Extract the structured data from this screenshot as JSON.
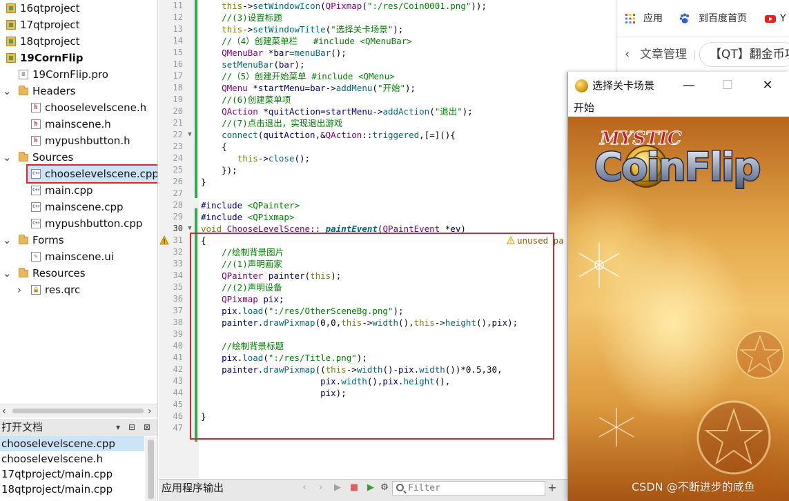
{
  "project_tree": {
    "items": [
      {
        "label": "16qtproject",
        "type": "project",
        "bold": false
      },
      {
        "label": "17qtproject",
        "type": "project",
        "bold": false
      },
      {
        "label": "18qtproject",
        "type": "project",
        "bold": false
      },
      {
        "label": "19CornFlip",
        "type": "project",
        "bold": true
      },
      {
        "label": "19CornFlip.pro",
        "type": "pro"
      },
      {
        "label": "Headers",
        "type": "folder",
        "expanded": true
      },
      {
        "label": "chooselevelscene.h",
        "type": "h"
      },
      {
        "label": "mainscene.h",
        "type": "h"
      },
      {
        "label": "mypushbutton.h",
        "type": "h"
      },
      {
        "label": "Sources",
        "type": "folder",
        "expanded": true
      },
      {
        "label": "chooselevelscene.cpp",
        "type": "cpp",
        "selected": true
      },
      {
        "label": "main.cpp",
        "type": "cpp"
      },
      {
        "label": "mainscene.cpp",
        "type": "cpp"
      },
      {
        "label": "mypushbutton.cpp",
        "type": "cpp"
      },
      {
        "label": "Forms",
        "type": "folder",
        "expanded": true
      },
      {
        "label": "mainscene.ui",
        "type": "ui"
      },
      {
        "label": "Resources",
        "type": "folder",
        "expanded": true
      },
      {
        "label": "res.qrc",
        "type": "qrc",
        "collapsed": true
      }
    ]
  },
  "open_documents": {
    "title": "打开文档",
    "items": [
      "chooselevelscene.cpp",
      "chooselevelscene.h",
      "17qtproject/main.cpp",
      "18qtproject/main.cpp"
    ]
  },
  "editor": {
    "highlight_color": "#d9252e",
    "warning_text": "unused pa",
    "warning_line": 30,
    "lines": [
      {
        "n": 11,
        "html": "    <span class='k'>this</span>-&gt;<span class='f'>setWindowIcon</span>(<span class='t'>QPixmap</span>(<span class='s'>\":/res/Coin0001.png\"</span>));"
      },
      {
        "n": 12,
        "html": "    <span class='cm'>//(3)设置标题</span>"
      },
      {
        "n": 13,
        "html": "    <span class='k'>this</span>-&gt;<span class='f'>setWindowTitle</span>(<span class='s'>\"选择关卡场景\"</span>);"
      },
      {
        "n": 14,
        "html": "    <span class='cm'>//（4）创建菜单栏   #include &lt;QMenuBar&gt;</span>"
      },
      {
        "n": 15,
        "html": "    <span class='t'>QMenuBar</span> *<span class='n'>bar</span>=<span class='f'>menuBar</span>();"
      },
      {
        "n": 16,
        "html": "    <span class='f'>setMenuBar</span>(<span class='n'>bar</span>);"
      },
      {
        "n": 17,
        "html": "    <span class='cm'>//（5）创建开始菜单 #include &lt;QMenu&gt;</span>"
      },
      {
        "n": 18,
        "html": "    <span class='t'>QMenu</span> *<span class='n'>startMenu</span>=<span class='n'>bar</span>-&gt;<span class='f'>addMenu</span>(<span class='s'>\"开始\"</span>);"
      },
      {
        "n": 19,
        "html": "    <span class='cm'>//(6)创建菜单项</span>"
      },
      {
        "n": 20,
        "html": "    <span class='t'>QAction</span> *<span class='n'>quitAction</span>=<span class='n'>startMenu</span>-&gt;<span class='f'>addAction</span>(<span class='s'>\"退出\"</span>);"
      },
      {
        "n": 21,
        "html": "    <span class='cm'>//(7)点击退出，实现退出游戏</span>"
      },
      {
        "n": 22,
        "html": "    <span class='f'>connect</span>(<span class='n'>quitAction</span>,&amp;<span class='t'>QAction</span>::<span class='f'>triggered</span>,[=](){"
      },
      {
        "n": 23,
        "html": "    {"
      },
      {
        "n": 24,
        "html": "       <span class='k'>this</span>-&gt;<span class='f'>close</span>();"
      },
      {
        "n": 25,
        "html": "    });"
      },
      {
        "n": 26,
        "html": "}"
      },
      {
        "n": 27,
        "html": ""
      },
      {
        "n": 28,
        "html": "<span class='pp'>#include</span> <span class='s'>&lt;QPainter&gt;</span>"
      },
      {
        "n": 29,
        "html": "<span class='pp'>#include</span> <span class='s'>&lt;QPixmap&gt;</span>"
      },
      {
        "n": 30,
        "html": "<span class='k'>void</span> <span class='t'>ChooseLevelScene</span>:: <span class='fi'>paintEvent</span>(<span class='t'>QPaintEvent</span> *<span class='n' style='text-decoration:underline'>ev</span>)"
      },
      {
        "n": 31,
        "html": "{"
      },
      {
        "n": 32,
        "html": "    <span class='cm'>//绘制背景图片</span>"
      },
      {
        "n": 33,
        "html": "    <span class='cm'>//(1)声明画家</span>"
      },
      {
        "n": 34,
        "html": "    <span class='t'>QPainter</span> <span class='n'>painter</span>(<span class='k'>this</span>);"
      },
      {
        "n": 35,
        "html": "    <span class='cm'>//(2)声明设备</span>"
      },
      {
        "n": 36,
        "html": "    <span class='t'>QPixmap</span> <span class='n'>pix</span>;"
      },
      {
        "n": 37,
        "html": "    <span class='n'>pix</span>.<span class='f'>load</span>(<span class='s'>\":/res/OtherSceneBg.png\"</span>);"
      },
      {
        "n": 38,
        "html": "    <span class='n'>painter</span>.<span class='f'>drawPixmap</span>(0,0,<span class='k'>this</span>-&gt;<span class='f'>width</span>(),<span class='k'>this</span>-&gt;<span class='f'>height</span>(),<span class='n'>pix</span>);"
      },
      {
        "n": 39,
        "html": ""
      },
      {
        "n": 40,
        "html": "    <span class='cm'>//绘制背景标题</span>"
      },
      {
        "n": 41,
        "html": "    <span class='n'>pix</span>.<span class='f'>load</span>(<span class='s'>\":/res/Title.png\"</span>);"
      },
      {
        "n": 42,
        "html": "    <span class='n'>painter</span>.<span class='f'>drawPixmap</span>((<span class='k'>this</span>-&gt;<span class='f'>width</span>()-<span class='n'>pix</span>.<span class='f'>width</span>())*0.5,30,"
      },
      {
        "n": 43,
        "html": "                       <span class='n'>pix</span>.<span class='f'>width</span>(),<span class='n'>pix</span>.<span class='f'>height</span>(),"
      },
      {
        "n": 44,
        "html": "                       <span class='n'>pix</span>);"
      },
      {
        "n": 45,
        "html": ""
      },
      {
        "n": 46,
        "html": "}"
      },
      {
        "n": 47,
        "html": ""
      }
    ]
  },
  "output_bar": {
    "title": "应用程序输出",
    "filter_placeholder": "Filter"
  },
  "browser": {
    "bookmarks": [
      {
        "label": "应用",
        "icon": "apps-grid-icon"
      },
      {
        "label": "到百度首页",
        "icon": "baidu-paw-icon"
      },
      {
        "label": "Y",
        "icon": "youtube-icon"
      }
    ],
    "back_label": "文章管理",
    "article_title": "【QT】翻金币项"
  },
  "app_window": {
    "title": "选择关卡场景",
    "menu_label": "开始",
    "scene_title": "CoinFlip",
    "scene_subtitle": "MYSTIC"
  },
  "watermark": "CSDN @不断进步的咸鱼"
}
